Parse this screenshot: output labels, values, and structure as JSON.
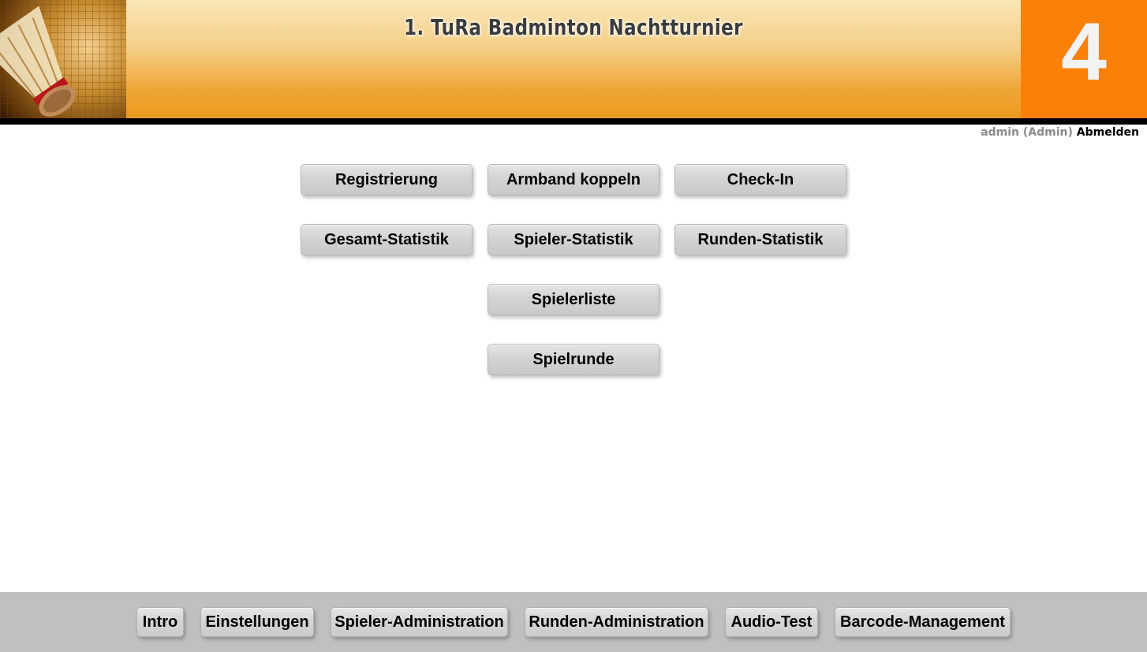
{
  "header": {
    "title": "1. TuRa Badminton Nachtturnier",
    "round_number": "4",
    "logo_icon": "shuttlecock-icon"
  },
  "user": {
    "name": "admin (Admin)",
    "logout_label": "Abmelden"
  },
  "main_buttons": {
    "registrierung": "Registrierung",
    "armband_koppeln": "Armband koppeln",
    "check_in": "Check-In",
    "gesamt_statistik": "Gesamt-Statistik",
    "spieler_statistik": "Spieler-Statistik",
    "runden_statistik": "Runden-Statistik",
    "spielerliste": "Spielerliste",
    "spielrunde": "Spielrunde"
  },
  "footer": {
    "intro": "Intro",
    "einstellungen": "Einstellungen",
    "spieler_administration": "Spieler-Administration",
    "runden_administration": "Runden-Administration",
    "audio_test": "Audio-Test",
    "barcode_management": "Barcode-Management"
  },
  "colors": {
    "accent_orange": "#fa8007",
    "header_gradient_top": "#f9e6b6",
    "header_gradient_bottom": "#ec9a1f",
    "footer_bg": "#c0c0c0"
  }
}
